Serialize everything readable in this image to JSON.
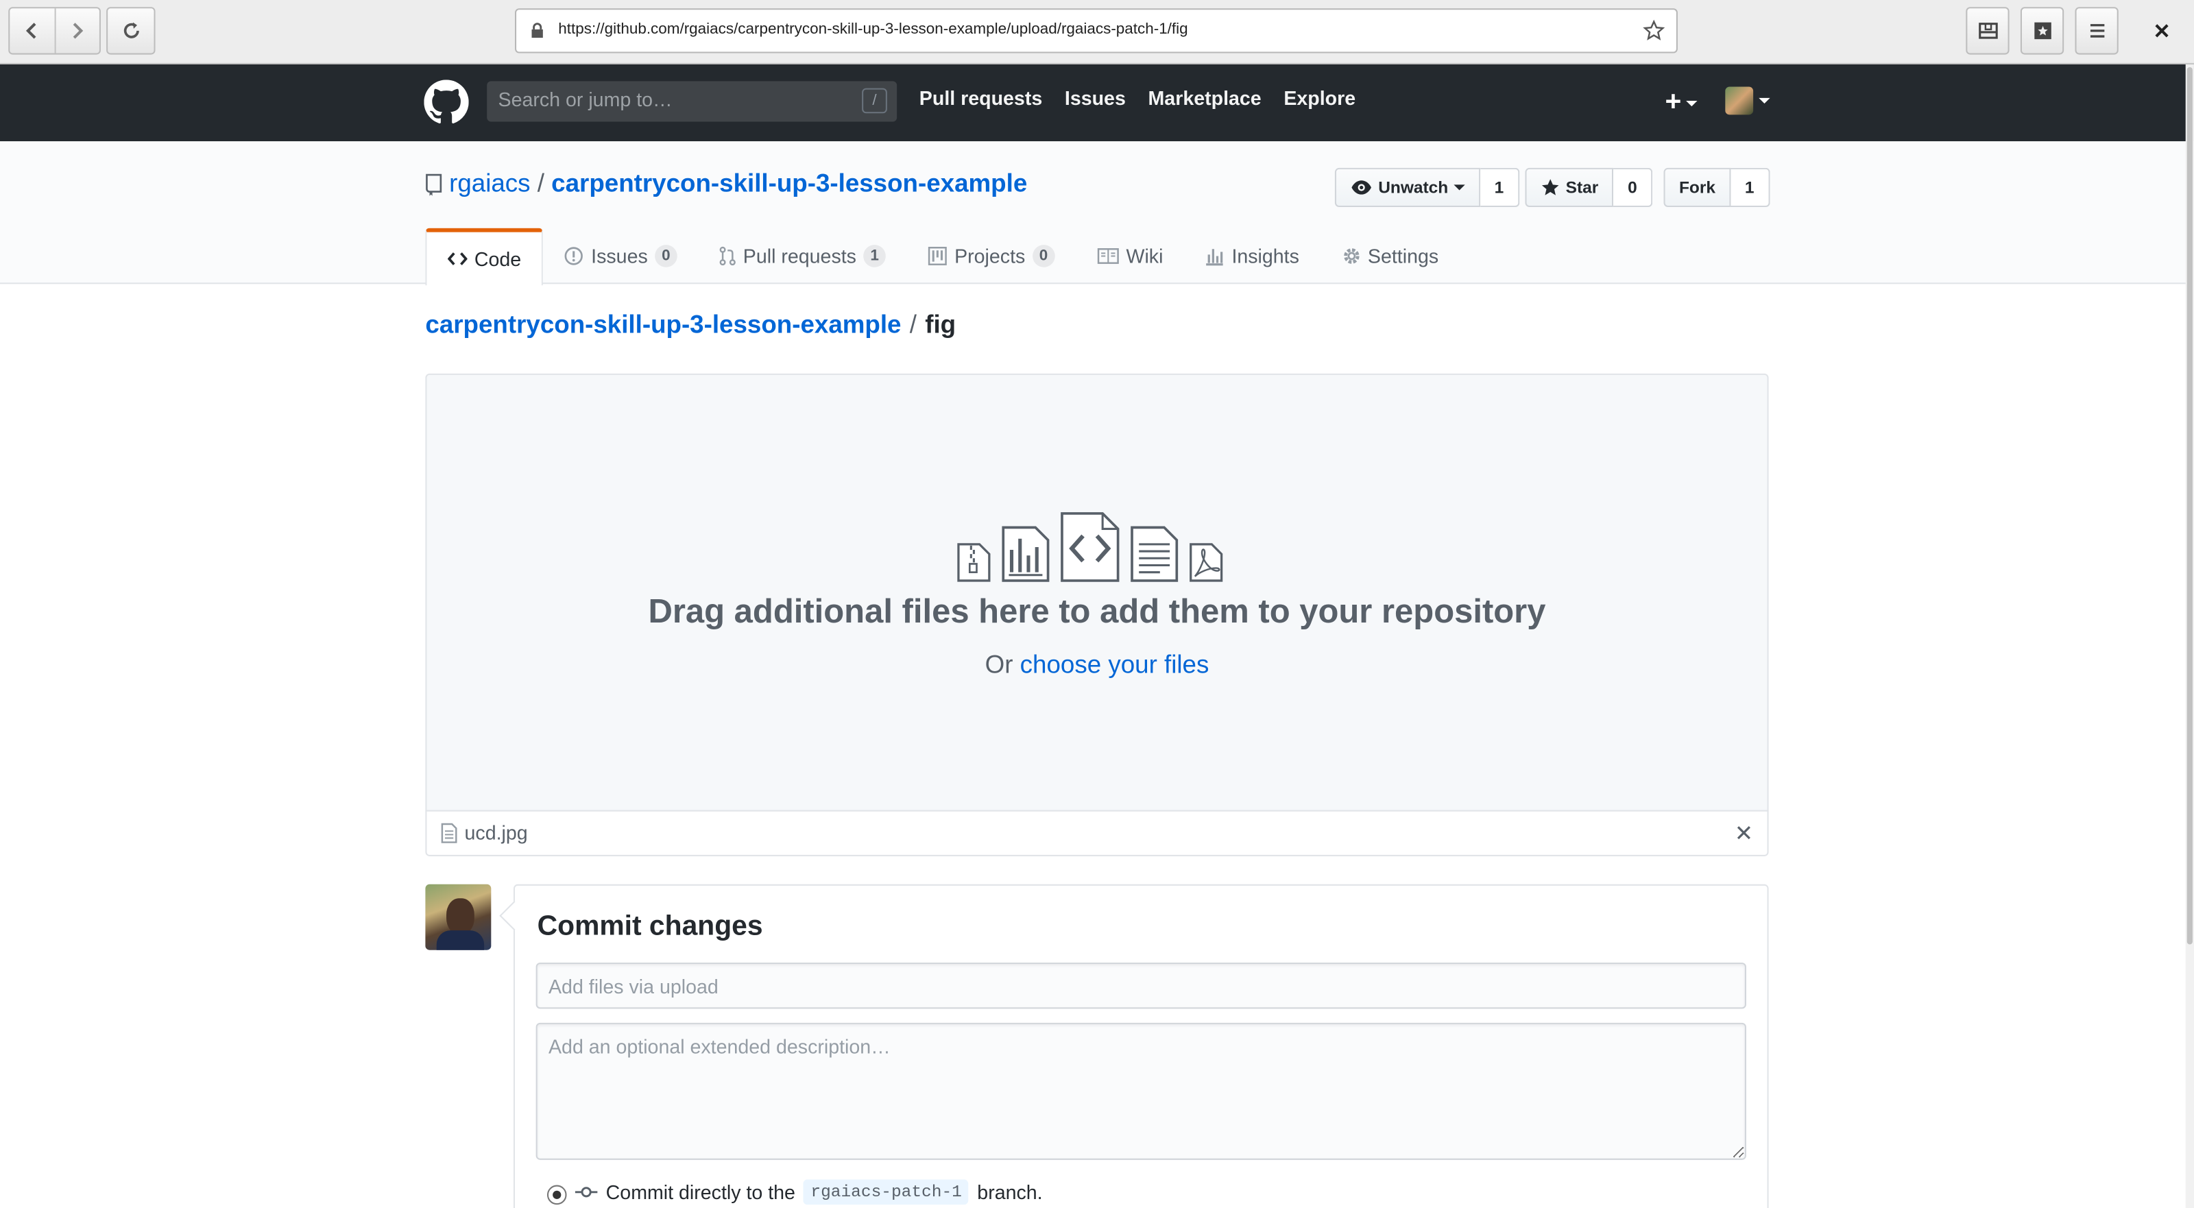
{
  "browser": {
    "url": "https://github.com/rgaiacs/carpentrycon-skill-up-3-lesson-example/upload/rgaiacs-patch-1/fig",
    "icons": [
      "back-icon",
      "forward-icon",
      "reload-icon",
      "lock-icon",
      "bookmark-star-icon",
      "library-icon",
      "sidebar-icon",
      "menu-icon",
      "close-icon"
    ]
  },
  "header": {
    "search_placeholder": "Search or jump to…",
    "search_shortcut": "/",
    "nav": [
      "Pull requests",
      "Issues",
      "Marketplace",
      "Explore"
    ],
    "plus": "+"
  },
  "repo": {
    "owner": "rgaiacs",
    "separator": "/",
    "name": "carpentrycon-skill-up-3-lesson-example",
    "watch_label": "Unwatch",
    "watch_count": "1",
    "star_label": "Star",
    "star_count": "0",
    "fork_label": "Fork",
    "fork_count": "1"
  },
  "tabs": [
    {
      "label": "Code",
      "selected": true
    },
    {
      "label": "Issues",
      "count": "0"
    },
    {
      "label": "Pull requests",
      "count": "1"
    },
    {
      "label": "Projects",
      "count": "0"
    },
    {
      "label": "Wiki"
    },
    {
      "label": "Insights"
    },
    {
      "label": "Settings"
    }
  ],
  "breadcrumb": {
    "repo": "carpentrycon-skill-up-3-lesson-example",
    "separator": "/",
    "dir": "fig"
  },
  "upload": {
    "title": "Drag additional files here to add them to your repository",
    "or": "Or",
    "choose_link": "choose your files",
    "files": [
      "ucd.jpg"
    ],
    "remove": "✕"
  },
  "commit": {
    "title": "Commit changes",
    "summary_placeholder": "Add files via upload",
    "description_placeholder": "Add an optional extended description…",
    "option_prefix": "Commit directly to the",
    "branch": "rgaiacs-patch-1",
    "option_suffix": "branch."
  },
  "colors": {
    "header_bg": "#24292e",
    "link": "#0366d6",
    "tab_accent": "#e36209"
  }
}
